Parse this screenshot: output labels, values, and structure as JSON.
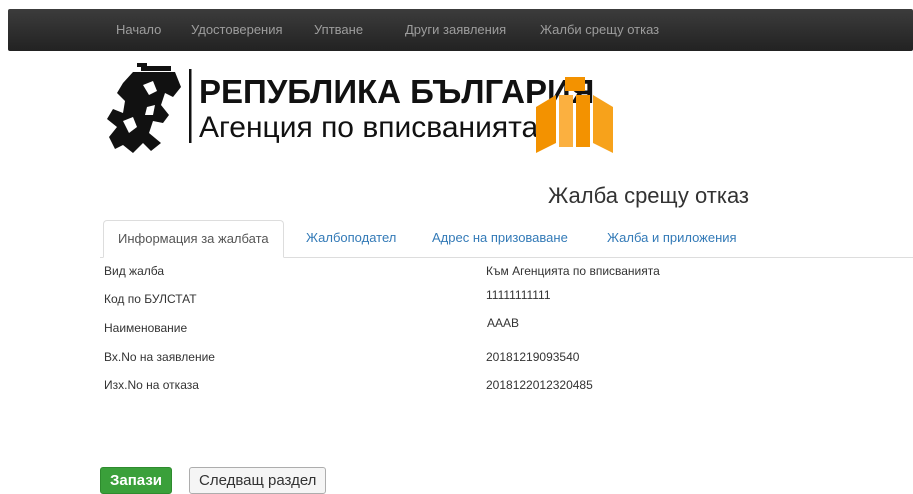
{
  "nav": {
    "items": [
      {
        "label": "Начало"
      },
      {
        "label": "Удостоверения"
      },
      {
        "label": "Уптване"
      },
      {
        "label": "Други заявления"
      },
      {
        "label": "Жалби срещу отказ"
      }
    ]
  },
  "header": {
    "logo_line1": "РЕПУБЛИКА БЪЛГАРИЯ",
    "logo_line2": "Агенция по вписванията"
  },
  "page": {
    "title": "Жалба срещу отказ"
  },
  "tabs": [
    {
      "label": "Информация за жалбата",
      "active": true
    },
    {
      "label": "Жалбоподател"
    },
    {
      "label": "Адрес на призоваване"
    },
    {
      "label": "Жалба и приложения"
    }
  ],
  "details": [
    {
      "label": "Вид жалба",
      "value": "Към Агенцията по вписванията"
    },
    {
      "label": "Код по БУЛСТАТ",
      "value": "11111111111"
    },
    {
      "label": "Наименование",
      "value": "AAAB"
    },
    {
      "label": "Вх.No на заявление",
      "value": "20181219093540"
    },
    {
      "label": "Изх.No на отказа",
      "value": "2018122012320485"
    }
  ],
  "buttons": {
    "save_label": "Запази",
    "next_label": "Следващ раздел"
  },
  "colors": {
    "navbar": "#222222",
    "link": "#337ab7",
    "save": "#3aa03a",
    "logo_orange": "#f39200"
  }
}
